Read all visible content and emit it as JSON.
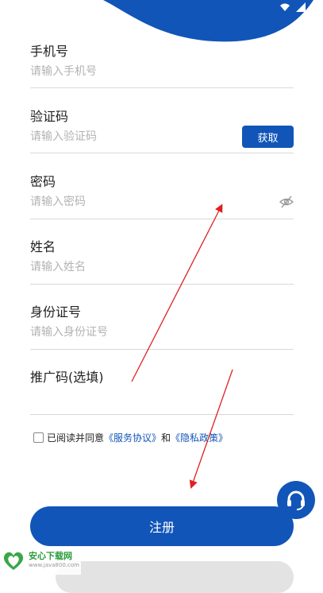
{
  "fields": [
    {
      "label": "手机号",
      "placeholder": "请输入手机号"
    },
    {
      "label": "验证码",
      "placeholder": "请输入验证码",
      "button": "获取"
    },
    {
      "label": "密码",
      "placeholder": "请输入密码"
    },
    {
      "label": "姓名",
      "placeholder": "请输入姓名"
    },
    {
      "label": "身份证号",
      "placeholder": "请输入身份证号"
    },
    {
      "label": "推广码(选填)",
      "placeholder": ""
    }
  ],
  "agreement": {
    "prefix": "已阅读并同意",
    "service_link": "《服务协议》",
    "conjunction": "和",
    "privacy_link": "《隐私政策》",
    "checked": false
  },
  "register_button": "注册",
  "watermark": {
    "title": "安心下载网",
    "url": "www.java800.com"
  },
  "colors": {
    "primary": "#1155b8",
    "annotation": "#e02020"
  },
  "icons": [
    "wifi-icon",
    "signal-icon",
    "eye-off-icon",
    "headset-icon"
  ]
}
